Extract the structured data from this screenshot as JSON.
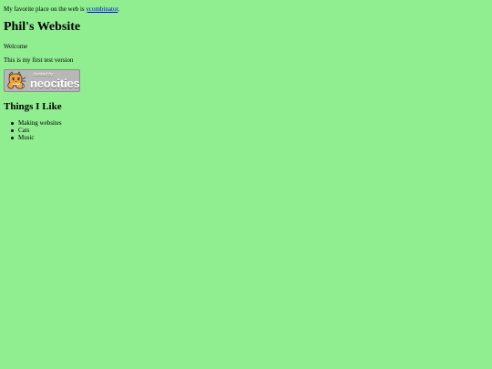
{
  "intro": {
    "prefix": "My favorite place on the web is ",
    "link_text": "ycombinator",
    "suffix": "."
  },
  "title": "Phil's Website",
  "welcome": "Welcome",
  "version_note": "This is my first test version",
  "badge": {
    "hosted_text": "hosted by",
    "brand_text": "neocities"
  },
  "section": {
    "title": "Things I Like",
    "items": [
      "Making websites",
      "Cats",
      "Music"
    ]
  },
  "colors": {
    "background": "#90ee90",
    "link": "#0000ee",
    "text": "#000000"
  },
  "icons": {
    "badge_mascot": "cat-icon"
  }
}
